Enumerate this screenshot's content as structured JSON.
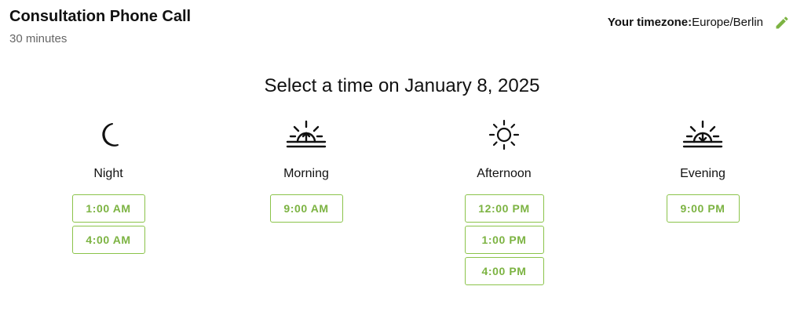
{
  "event": {
    "title": "Consultation Phone Call",
    "duration": "30 minutes"
  },
  "timezone": {
    "label": "Your timezone:",
    "value": "Europe/Berlin",
    "edit_icon": "pencil-icon"
  },
  "heading": "Select a time on January 8, 2025",
  "periods": [
    {
      "label": "Night",
      "icon": "moon-icon",
      "slots": [
        "1:00 AM",
        "4:00 AM"
      ]
    },
    {
      "label": "Morning",
      "icon": "sunrise-icon",
      "slots": [
        "9:00 AM"
      ]
    },
    {
      "label": "Afternoon",
      "icon": "sun-icon",
      "slots": [
        "12:00 PM",
        "1:00 PM",
        "4:00 PM"
      ]
    },
    {
      "label": "Evening",
      "icon": "sunset-icon",
      "slots": [
        "9:00 PM"
      ]
    }
  ],
  "colors": {
    "accent": "#8bc34a",
    "accent_text": "#7cb342",
    "text": "#111111",
    "muted": "#666666"
  }
}
